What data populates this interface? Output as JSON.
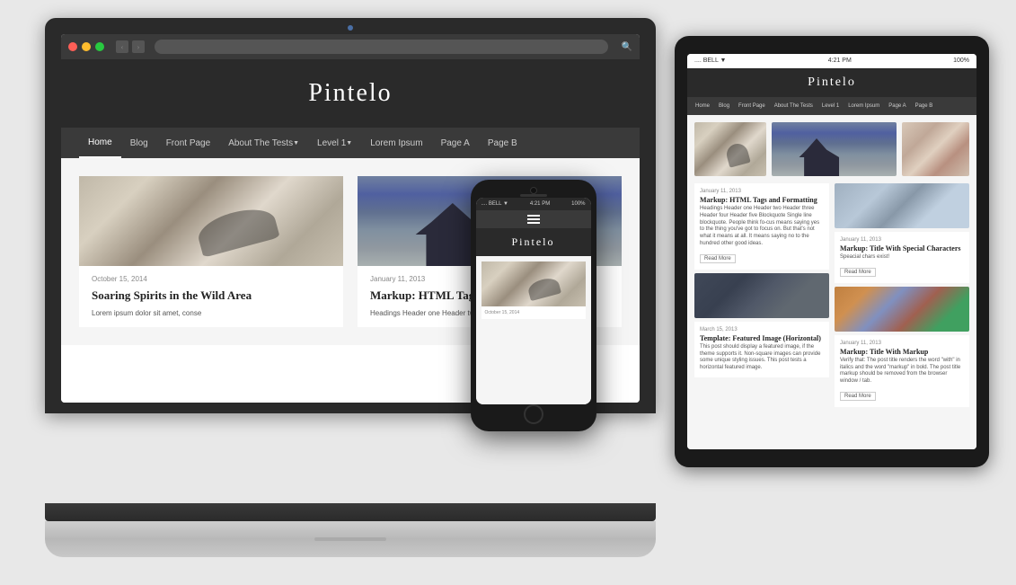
{
  "scene": {
    "background": "#e0e0e0"
  },
  "laptop": {
    "site_title": "Pintelo",
    "nav_items": [
      "Home",
      "Blog",
      "Front Page",
      "About The Tests",
      "Level 1",
      "Lorem Ipsum",
      "Page A",
      "Page B"
    ],
    "cards": [
      {
        "date": "October 15, 2014",
        "title": "Soaring Spirits in the Wild Area",
        "excerpt": "Lorem ipsum dolor sit amet, conse"
      },
      {
        "date": "January 11, 2013",
        "title": "Markup: HTML Tags and Formatting",
        "excerpt": "Headings Header one Header two"
      }
    ]
  },
  "tablet": {
    "status_left": ".... BELL ▼",
    "status_time": "4:21 PM",
    "status_right": "100%",
    "site_title": "Pintelo",
    "nav_items": [
      "Home",
      "Blog",
      "Front Page",
      "About The Tests",
      "Level 1",
      "Lorem Ipsum",
      "Page A",
      "Page B"
    ],
    "articles": [
      {
        "date": "January 11, 2013",
        "title": "Markup: HTML Tags and Formatting",
        "excerpt": "Headings Header one Header two Header three Header four Header five Blockquote Single line blockquote. People think fo-cus means saying yes to the thing you've got to focus on. But that's not what it means at all. It means saying no to the hundred other good ideas.",
        "read_more": "Read More"
      },
      {
        "date": "March 15, 2013",
        "title": "Template: Featured Image (Horizontal)",
        "excerpt": "This post should display a featured image, if the theme supports it. Non-square images can provide some unique styling issues. This post tests a horizontal featured image.",
        "read_more": "Read More"
      }
    ],
    "right_articles": [
      {
        "date": "January 11, 2013",
        "title": "Markup: Title With Special Characters",
        "excerpt": "Speacial chars exist!",
        "read_more": "Read More"
      },
      {
        "date": "January 11, 2013",
        "title": "Markup: Title With Markup",
        "excerpt": "Verify that: The post title renders the word \"with\" in italics and the word \"markup\" in bold. The post title markup should be removed from the browser window / tab.",
        "read_more": "Read More"
      }
    ]
  },
  "phone": {
    "status_left": ".... BELL ▼",
    "status_time": "4:21 PM",
    "status_right": "100%",
    "site_title": "Pintelo",
    "card_date": "October 15, 2014"
  }
}
